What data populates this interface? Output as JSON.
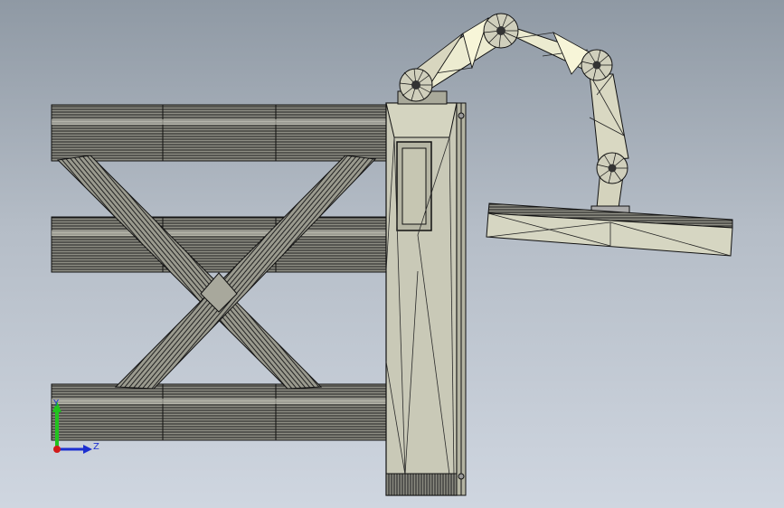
{
  "viewport": {
    "name": "cad-graphics-area",
    "background_top": "#8f99a4",
    "background_bottom": "#cfd6e0"
  },
  "model": {
    "parts": [
      "steel-frame",
      "vertical-column",
      "robot-arm",
      "gripper-plate"
    ],
    "wireframe_color": "#1a1a1a",
    "face_color": "#c7c7b2",
    "highlight_color": "#f2f2d4"
  },
  "triad": {
    "y_label": "Y",
    "z_label": "Z",
    "y_color": "#21c21f",
    "z_color": "#1c2fd0",
    "x_color": "#d11a1a"
  }
}
